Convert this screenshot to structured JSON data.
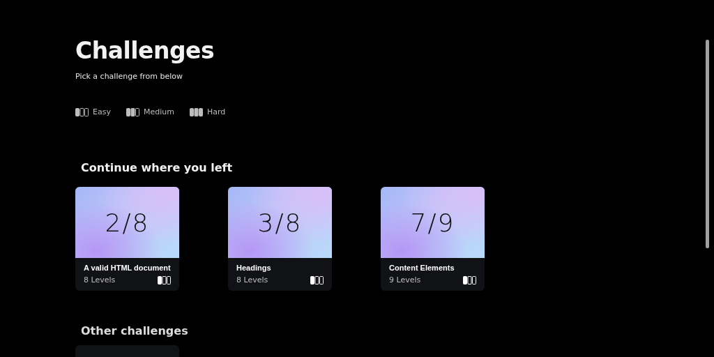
{
  "title": "Challenges",
  "subtitle": "Pick a challenge from below",
  "legend": [
    {
      "kind": "easy",
      "label": "Easy"
    },
    {
      "kind": "medium",
      "label": "Medium"
    },
    {
      "kind": "hard",
      "label": "Hard"
    }
  ],
  "continue_section": {
    "heading": "Continue where you left",
    "cards": [
      {
        "progress": "2/8",
        "name": "A valid HTML document",
        "levels": "8 Levels",
        "kind": "easy"
      },
      {
        "progress": "3/8",
        "name": "Headings",
        "levels": "8 Levels",
        "kind": "easy"
      },
      {
        "progress": "7/9",
        "name": "Content Elements",
        "levels": "9 Levels",
        "kind": "easy"
      }
    ]
  },
  "other_section": {
    "heading": "Other challenges"
  }
}
